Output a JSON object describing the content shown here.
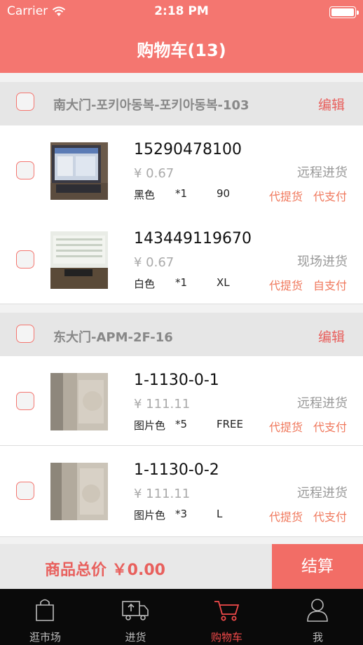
{
  "status": {
    "carrier": "Carrier",
    "time": "2:18 PM"
  },
  "nav": {
    "title": "购物车(13)"
  },
  "shops": [
    {
      "name": "南大门-포키아동복-포키아동복-103",
      "edit": "编辑",
      "items": [
        {
          "title": "15290478100",
          "price": "¥ 0.67",
          "color": "黑色",
          "qty": "*1",
          "size": "90",
          "mode": "远程进货",
          "action1": "代提货",
          "action2": "代支付"
        },
        {
          "title": "143449119670",
          "price": "¥ 0.67",
          "color": "白色",
          "qty": "*1",
          "size": "XL",
          "mode": "现场进货",
          "action1": "代提货",
          "action2": "自支付"
        }
      ]
    },
    {
      "name": "东大门-APM-2F-16",
      "edit": "编辑",
      "items": [
        {
          "title": "1-1130-0-1",
          "price": "¥ 111.11",
          "color": "图片色",
          "qty": "*5",
          "size": "FREE",
          "mode": "远程进货",
          "action1": "代提货",
          "action2": "代支付"
        },
        {
          "title": "1-1130-0-2",
          "price": "¥ 111.11",
          "color": "图片色",
          "qty": "*3",
          "size": "L",
          "mode": "远程进货",
          "action1": "代提货",
          "action2": "代支付"
        }
      ]
    }
  ],
  "footer": {
    "total": "商品总价 ￥0.00",
    "checkout": "结算"
  },
  "tabs": [
    {
      "label": "逛市场",
      "icon": "shopping-bag-icon"
    },
    {
      "label": "进货",
      "icon": "delivery-truck-icon"
    },
    {
      "label": "购物车",
      "icon": "cart-icon",
      "active": true
    },
    {
      "label": "我",
      "icon": "user-icon"
    }
  ],
  "colors": {
    "accent": "#f47670",
    "checkout": "#f26d66",
    "active_tab": "#f24a4a"
  }
}
